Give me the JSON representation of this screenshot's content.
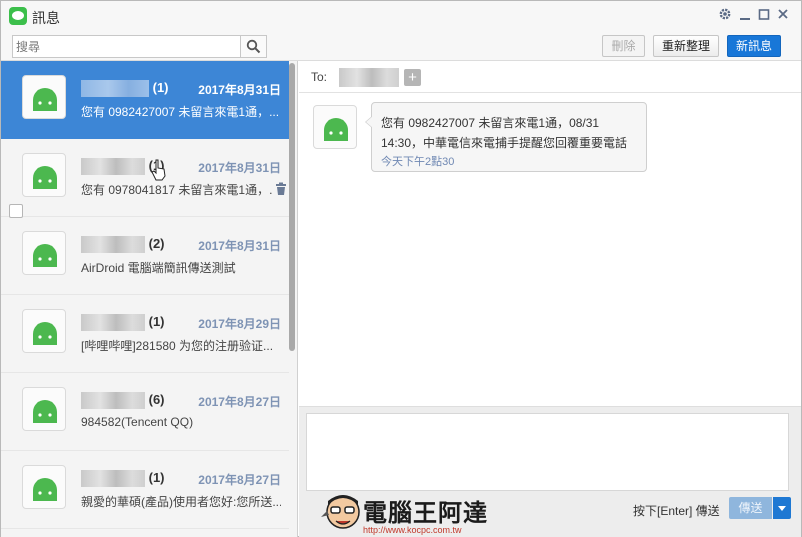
{
  "window": {
    "title": "訊息"
  },
  "toolbar": {
    "search_placeholder": "搜尋",
    "delete_label": "刪除",
    "refresh_label": "重新整理",
    "new_message_label": "新訊息"
  },
  "conversations": [
    {
      "count": "(1)",
      "date": "2017年8月31日",
      "preview": "您有 0982427007 未留言來電1通，...",
      "selected": true
    },
    {
      "count": "(1)",
      "date": "2017年8月31日",
      "preview": "您有 0978041817 未留言來電1通，...",
      "selected": false
    },
    {
      "count": "(2)",
      "date": "2017年8月31日",
      "preview": "AirDroid 電腦端簡訊傳送測試",
      "selected": false
    },
    {
      "count": "(1)",
      "date": "2017年8月29日",
      "preview": "[哔哩哔哩]281580 为您的注册验证...",
      "selected": false
    },
    {
      "count": "(6)",
      "date": "2017年8月27日",
      "preview": "984582(Tencent QQ)",
      "selected": false
    },
    {
      "count": "(1)",
      "date": "2017年8月27日",
      "preview": "親愛的華碩(產品)使用者您好:您所送...",
      "selected": false
    }
  ],
  "recipient": {
    "to_label": "To:"
  },
  "message": {
    "text": "您有 0982427007 未留言來電1通，08/31 14:30，中華電信來電捕手提醒您回覆重要電話",
    "time": "今天下午2點30"
  },
  "compose": {
    "hint": "按下[Enter] 傳送",
    "send_label": "傳送"
  },
  "watermark": {
    "title": "電腦王阿達",
    "url": "http://www.kocpc.com.tw"
  },
  "colors": {
    "accent": "#1877d8",
    "selected_row": "#3d86d6",
    "android_green": "#4cb84f"
  }
}
